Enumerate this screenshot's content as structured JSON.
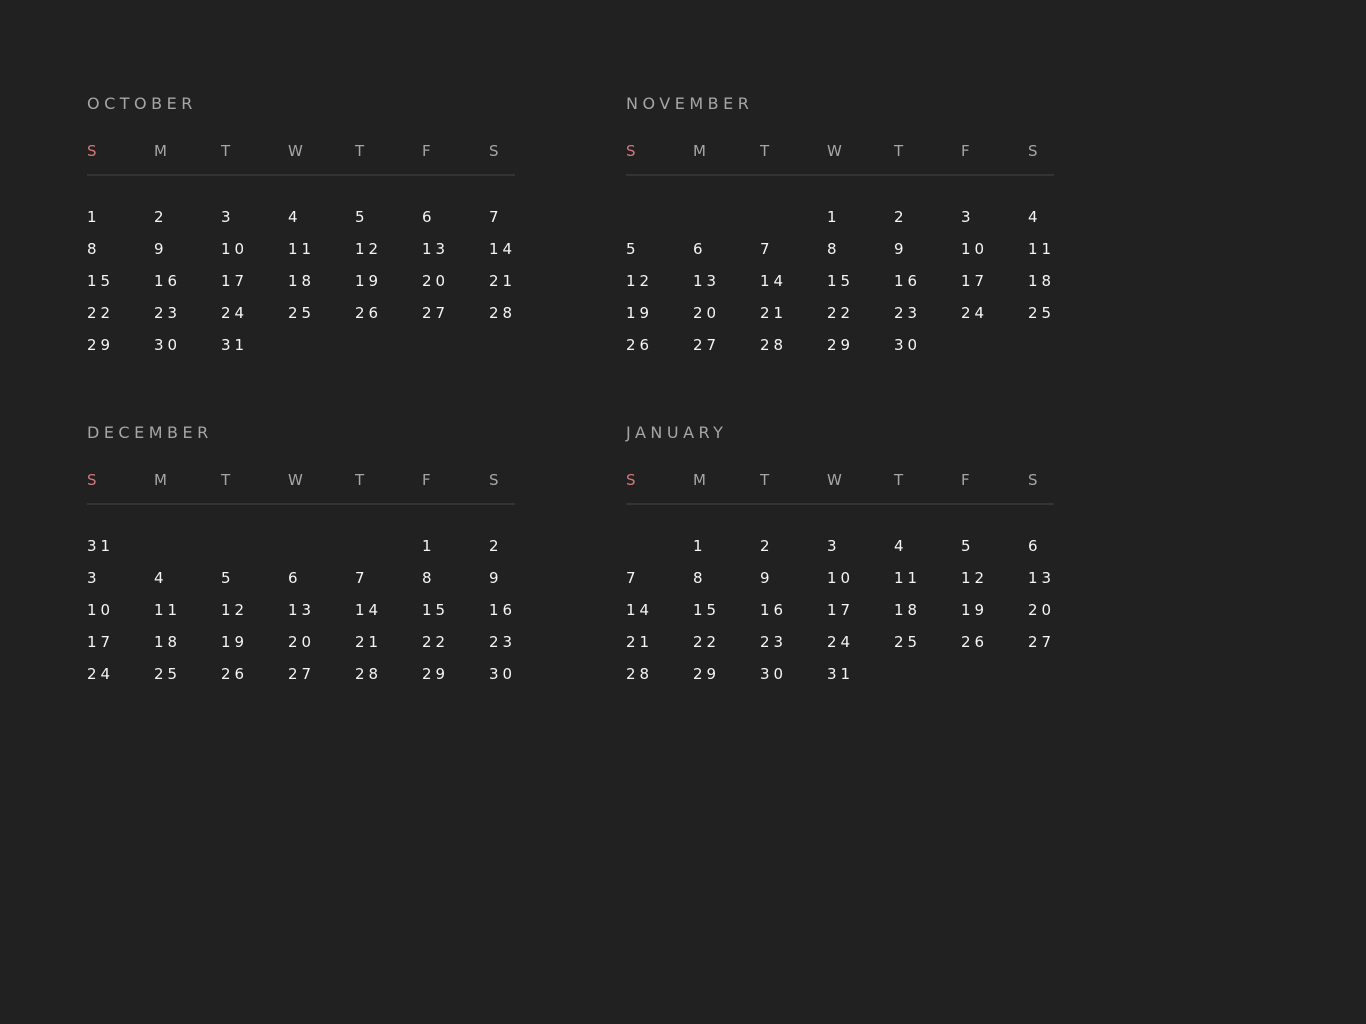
{
  "weekdays": [
    "S",
    "M",
    "T",
    "W",
    "T",
    "F",
    "S"
  ],
  "colors": {
    "background": "#212121",
    "sunday": "#d2787a",
    "label": "#a6a6a6",
    "day": "#f5f5f5",
    "divider": "#333333"
  },
  "months": [
    {
      "name": "OCTOBER",
      "weeks": [
        [
          "1",
          "2",
          "3",
          "4",
          "5",
          "6",
          "7"
        ],
        [
          "8",
          "9",
          "10",
          "11",
          "12",
          "13",
          "14"
        ],
        [
          "15",
          "16",
          "17",
          "18",
          "19",
          "20",
          "21"
        ],
        [
          "22",
          "23",
          "24",
          "25",
          "26",
          "27",
          "28"
        ],
        [
          "29",
          "30",
          "31",
          "",
          "",
          "",
          ""
        ]
      ]
    },
    {
      "name": "NOVEMBER",
      "weeks": [
        [
          "",
          "",
          "",
          "1",
          "2",
          "3",
          "4"
        ],
        [
          "5",
          "6",
          "7",
          "8",
          "9",
          "10",
          "11"
        ],
        [
          "12",
          "13",
          "14",
          "15",
          "16",
          "17",
          "18"
        ],
        [
          "19",
          "20",
          "21",
          "22",
          "23",
          "24",
          "25"
        ],
        [
          "26",
          "27",
          "28",
          "29",
          "30",
          "",
          ""
        ]
      ]
    },
    {
      "name": "DECEMBER",
      "weeks": [
        [
          "31",
          "",
          "",
          "",
          "",
          "1",
          "2"
        ],
        [
          "3",
          "4",
          "5",
          "6",
          "7",
          "8",
          "9"
        ],
        [
          "10",
          "11",
          "12",
          "13",
          "14",
          "15",
          "16"
        ],
        [
          "17",
          "18",
          "19",
          "20",
          "21",
          "22",
          "23"
        ],
        [
          "24",
          "25",
          "26",
          "27",
          "28",
          "29",
          "30"
        ]
      ]
    },
    {
      "name": "JANUARY",
      "weeks": [
        [
          "",
          "1",
          "2",
          "3",
          "4",
          "5",
          "6"
        ],
        [
          "7",
          "8",
          "9",
          "10",
          "11",
          "12",
          "13"
        ],
        [
          "14",
          "15",
          "16",
          "17",
          "18",
          "19",
          "20"
        ],
        [
          "21",
          "22",
          "23",
          "24",
          "25",
          "26",
          "27"
        ],
        [
          "28",
          "29",
          "30",
          "31",
          "",
          "",
          ""
        ]
      ]
    }
  ]
}
